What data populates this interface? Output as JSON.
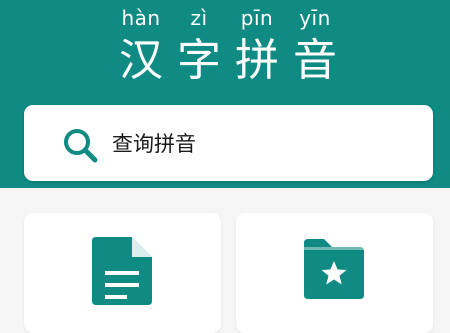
{
  "colors": {
    "brand": "#0f8b84",
    "background": "#f5f5f5",
    "surface": "#ffffff"
  },
  "title": [
    {
      "pinyin": "hàn",
      "hanzi": "汉"
    },
    {
      "pinyin": "zì",
      "hanzi": "字"
    },
    {
      "pinyin": "pīn",
      "hanzi": "拼"
    },
    {
      "pinyin": "yīn",
      "hanzi": "音"
    }
  ],
  "search": {
    "icon": "search-icon",
    "placeholder": "查询拼音"
  },
  "cards": [
    {
      "icon": "document-icon"
    },
    {
      "icon": "star-folder-icon"
    }
  ]
}
